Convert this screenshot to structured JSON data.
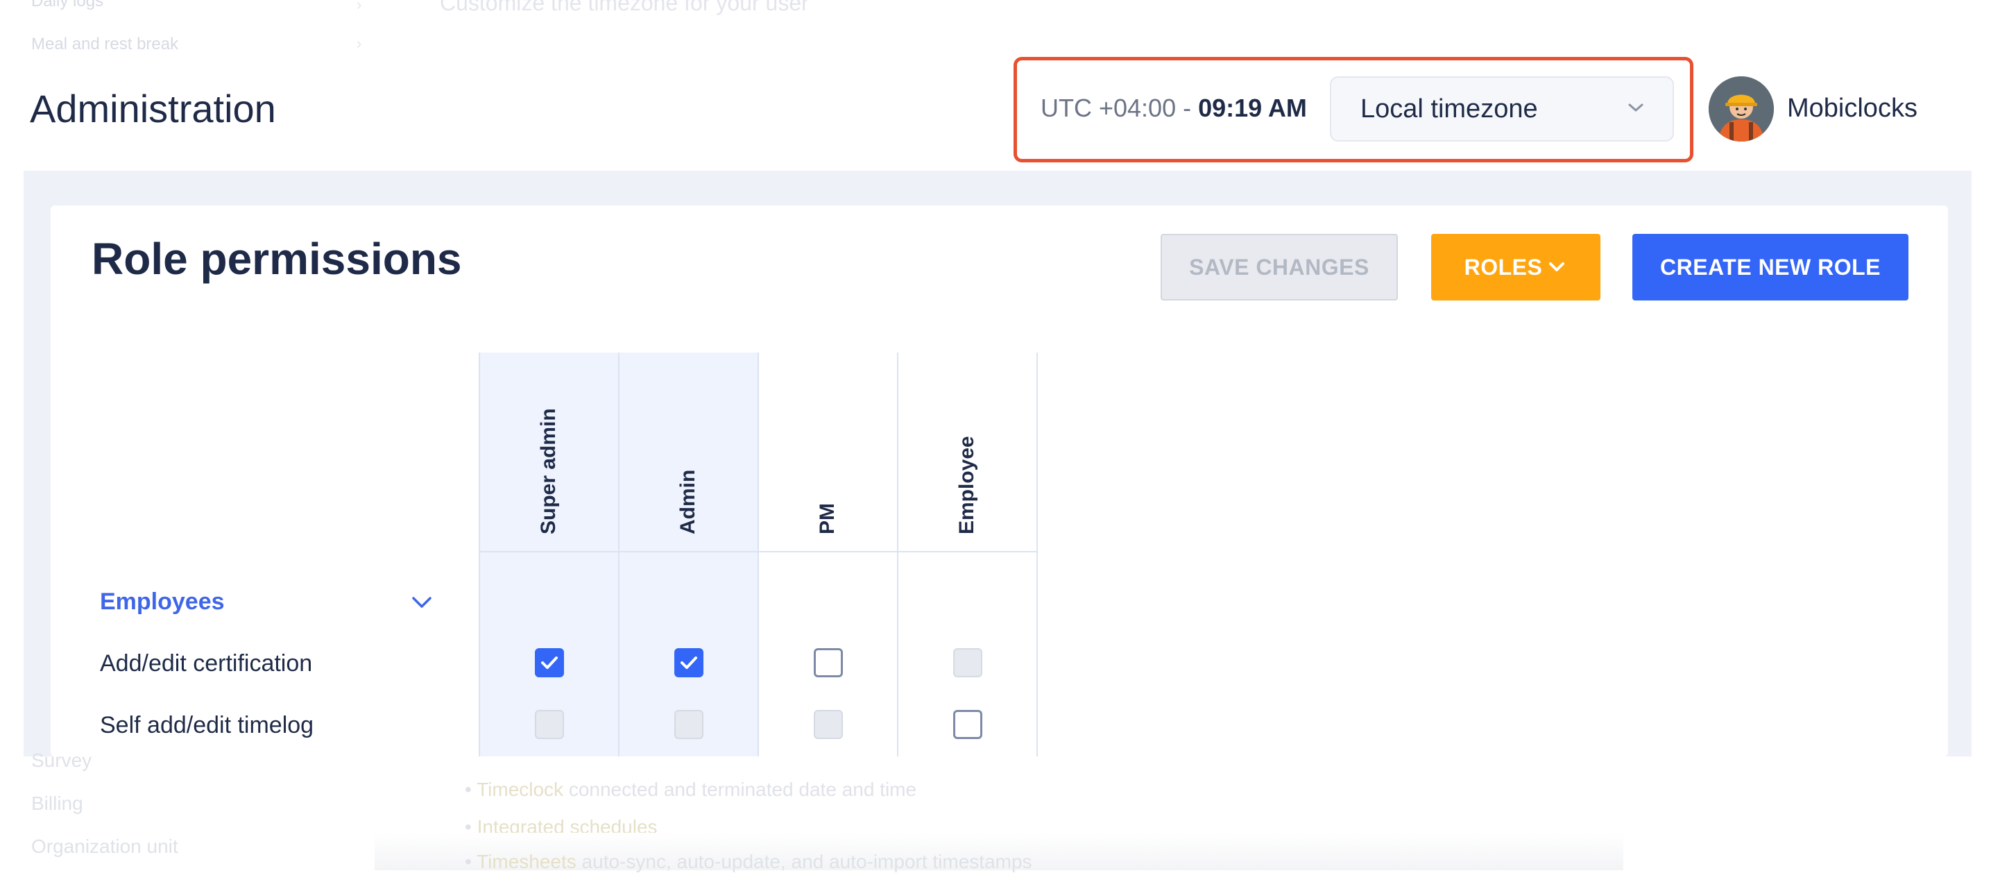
{
  "background_page": {
    "top_items": [
      "Daily logs",
      "Meal and rest break"
    ],
    "top_subtitle": "Customize the timezone for your user",
    "bottom_sidebar": [
      "Survey",
      "Billing",
      "Organization unit"
    ],
    "bottom_lines": [
      {
        "link": "Timeclock",
        "text": "connected and terminated date and time"
      },
      {
        "link": "Integrated schedules",
        "text": ""
      },
      {
        "link": "Timesheets",
        "text": "auto-sync, auto-update, and auto-import timestamps"
      }
    ]
  },
  "header": {
    "title": "Administration",
    "timezone": {
      "offset_prefix": "UTC +04:00 - ",
      "time": "09:19 AM",
      "select_value": "Local timezone"
    },
    "user": {
      "name": "Mobiclocks"
    }
  },
  "card": {
    "title": "Role permissions",
    "buttons": {
      "save": "SAVE CHANGES",
      "roles": "ROLES",
      "create": "CREATE NEW ROLE"
    },
    "columns": [
      "Super admin",
      "Admin",
      "PM",
      "Employee"
    ],
    "section": "Employees",
    "rows": [
      {
        "label": "Add/edit certification",
        "states": [
          "checked",
          "checked",
          "empty",
          "disabled"
        ]
      },
      {
        "label": "Self add/edit timelog",
        "states": [
          "disabled",
          "disabled",
          "disabled",
          "empty"
        ]
      }
    ]
  },
  "colors": {
    "accent_blue": "#3366f6",
    "roles_orange": "#ffa50f",
    "highlight_red": "#e8502f",
    "section_blue": "#3f66e8"
  },
  "icons": [
    "chevron-down-icon",
    "check-icon",
    "avatar-worker-icon"
  ]
}
